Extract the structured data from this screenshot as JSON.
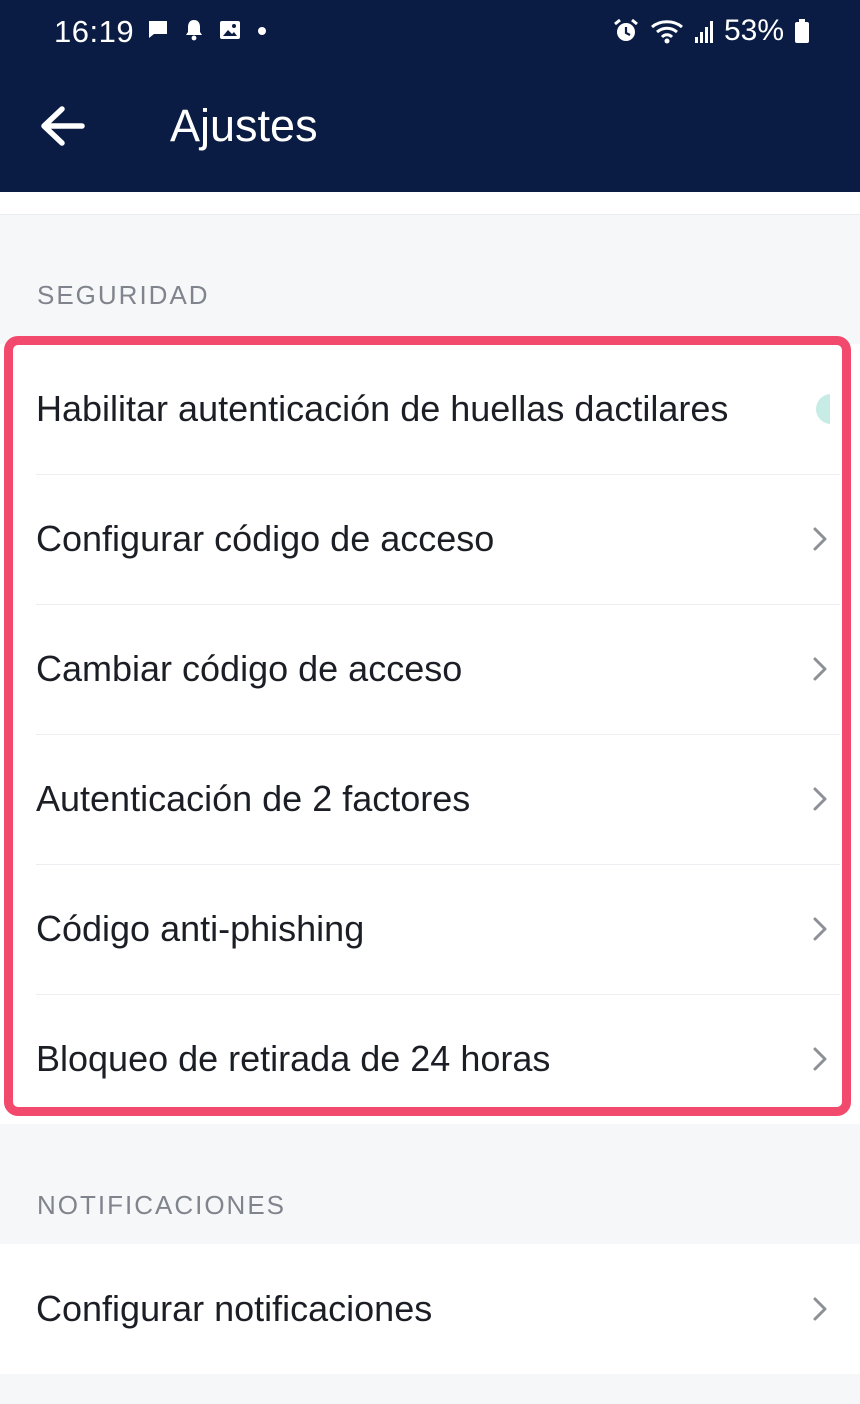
{
  "status_bar": {
    "time": "16:19",
    "battery": "53%",
    "left_icons": [
      "chat-icon",
      "bell-icon",
      "image-icon",
      "dot-icon"
    ],
    "right_icons": [
      "alarm-icon",
      "wifi-icon",
      "signal-icon",
      "battery-icon"
    ]
  },
  "header": {
    "back_icon": "arrow-left-icon",
    "title": "Ajustes"
  },
  "sections": {
    "security": {
      "label": "SEGURIDAD",
      "items": [
        {
          "label": "Habilitar autenticación de huellas dactilares",
          "control": "toggle"
        },
        {
          "label": "Configurar código de acceso",
          "control": "chevron"
        },
        {
          "label": "Cambiar código de acceso",
          "control": "chevron"
        },
        {
          "label": "Autenticación de 2 factores",
          "control": "chevron"
        },
        {
          "label": "Código anti-phishing",
          "control": "chevron"
        },
        {
          "label": "Bloqueo de retirada de 24 horas",
          "control": "chevron"
        }
      ]
    },
    "notifications": {
      "label": "NOTIFICACIONES",
      "items": [
        {
          "label": "Configurar notificaciones",
          "control": "chevron"
        }
      ]
    }
  },
  "colors": {
    "header_bg": "#0a1c43",
    "highlight_border": "#f24a6d",
    "toggle_accent": "#c6ece5",
    "page_bg": "#f6f7f9"
  }
}
